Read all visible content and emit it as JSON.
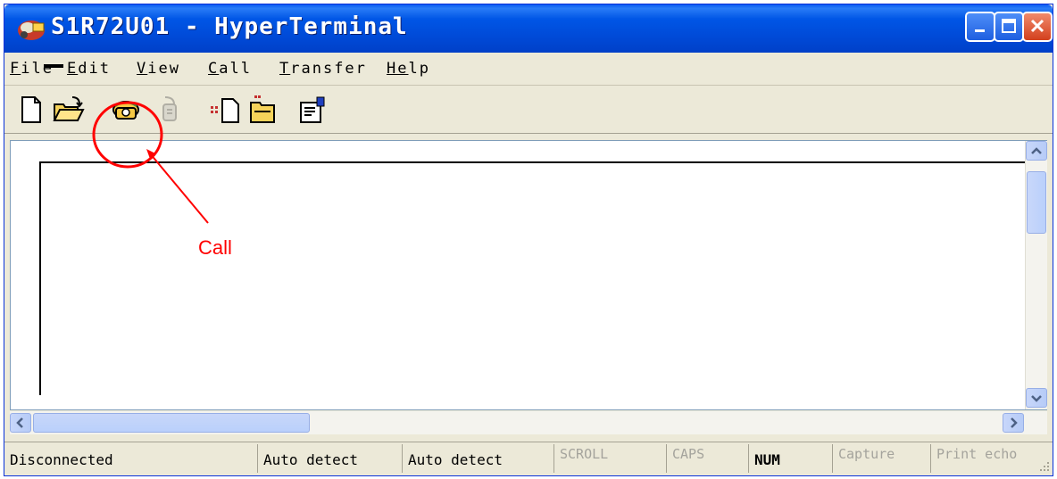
{
  "window": {
    "title": "S1R72U01 - HyperTerminal",
    "app_icon": "hyperterminal-icon",
    "controls": [
      "minimize-icon",
      "maximize-icon",
      "close-icon"
    ]
  },
  "menubar": {
    "items": [
      {
        "label": "ile",
        "mnemonic": "F"
      },
      {
        "label": "dit",
        "mnemonic": "E"
      },
      {
        "label": "iew",
        "mnemonic": "V"
      },
      {
        "label": "all",
        "mnemonic": "C"
      },
      {
        "label": "ransfer",
        "mnemonic": "T"
      },
      {
        "label": "lp",
        "mnemonic": "He"
      }
    ]
  },
  "toolbar": {
    "buttons": [
      {
        "icon": "new-document-icon"
      },
      {
        "icon": "open-folder-icon"
      },
      {
        "icon": "call-phone-icon"
      },
      {
        "icon": "disconnect-phone-icon",
        "disabled": true
      },
      {
        "icon": "send-file-icon"
      },
      {
        "icon": "receive-file-icon"
      },
      {
        "icon": "properties-icon"
      }
    ]
  },
  "annotation": {
    "label": "Call",
    "color": "#ff0000"
  },
  "statusbar": {
    "connection": "Disconnected",
    "emulation": "Auto detect",
    "port_settings": "Auto detect",
    "scroll": "SCROLL",
    "caps": "CAPS",
    "num": "NUM",
    "capture": "Capture",
    "print_echo": "Print echo"
  },
  "colors": {
    "titlebar": "#0056e6",
    "window_face": "#ece9d8",
    "annotation": "#ff0000"
  }
}
